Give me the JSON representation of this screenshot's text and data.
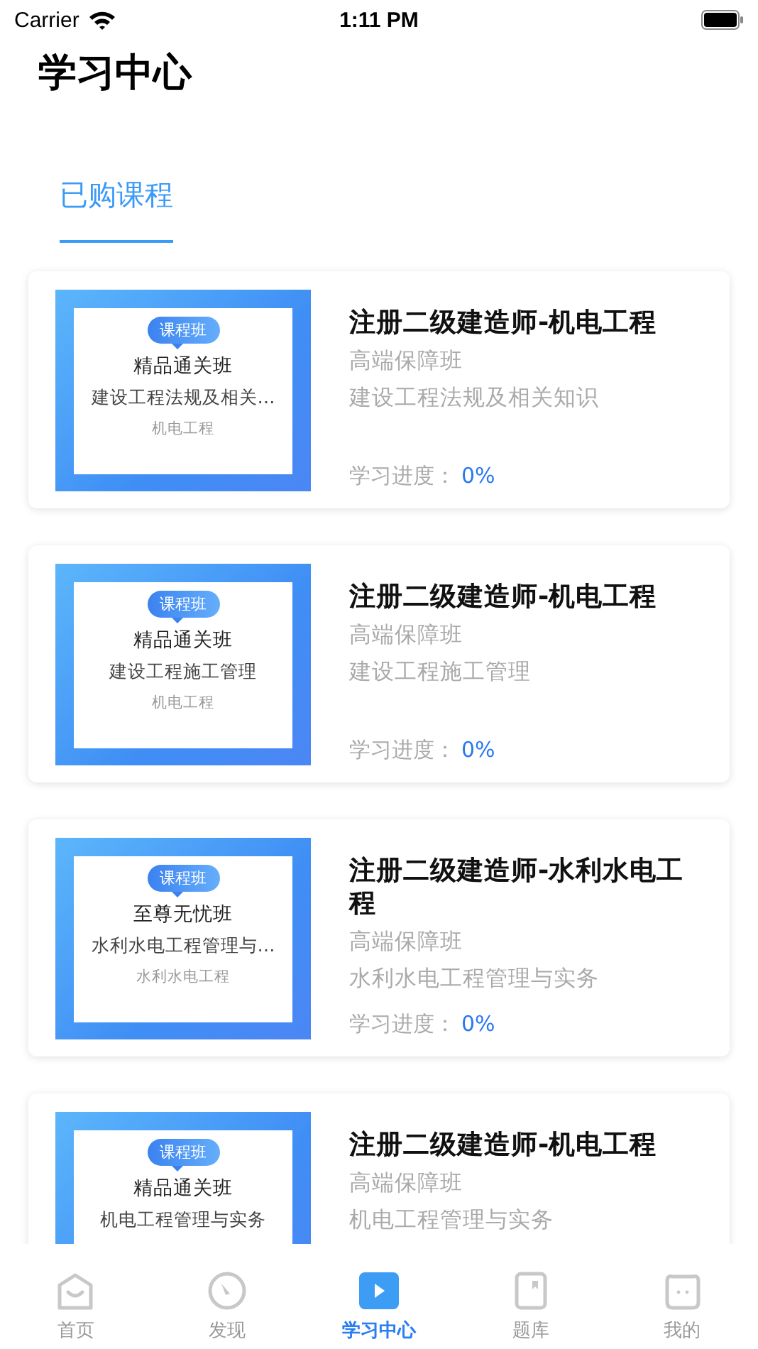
{
  "status_bar": {
    "carrier": "Carrier",
    "time": "1:11 PM"
  },
  "page_title": "学习中心",
  "tabs": [
    {
      "label": "已购课程",
      "selected": true
    }
  ],
  "courses": [
    {
      "thumb": {
        "badge": "课程班",
        "plan": "精品通关班",
        "subject": "建设工程法规及相关…",
        "major": "机电工程"
      },
      "title": "注册二级建造师-机电工程",
      "plan": "高端保障班",
      "subject": "建设工程法规及相关知识",
      "progress_label": "学习进度：",
      "progress": "0%"
    },
    {
      "thumb": {
        "badge": "课程班",
        "plan": "精品通关班",
        "subject": "建设工程施工管理",
        "major": "机电工程"
      },
      "title": "注册二级建造师-机电工程",
      "plan": "高端保障班",
      "subject": "建设工程施工管理",
      "progress_label": "学习进度：",
      "progress": "0%"
    },
    {
      "thumb": {
        "badge": "课程班",
        "plan": "至尊无忧班",
        "subject": "水利水电工程管理与…",
        "major": "水利水电工程"
      },
      "title": "注册二级建造师-水利水电工程",
      "plan": "高端保障班",
      "subject": "水利水电工程管理与实务",
      "progress_label": "学习进度：",
      "progress": "0%"
    },
    {
      "thumb": {
        "badge": "课程班",
        "plan": "精品通关班",
        "subject": "机电工程管理与实务"
      },
      "title": "注册二级建造师-机电工程",
      "plan": "高端保障班",
      "subject": "机电工程管理与实务"
    }
  ],
  "tab_bar": [
    {
      "kind": "home",
      "label": "首页",
      "selected": false
    },
    {
      "kind": "discover",
      "label": "发现",
      "selected": false
    },
    {
      "kind": "study",
      "label": "学习中心",
      "selected": true
    },
    {
      "kind": "bank",
      "label": "题库",
      "selected": false
    },
    {
      "kind": "me",
      "label": "我的",
      "selected": false
    }
  ]
}
